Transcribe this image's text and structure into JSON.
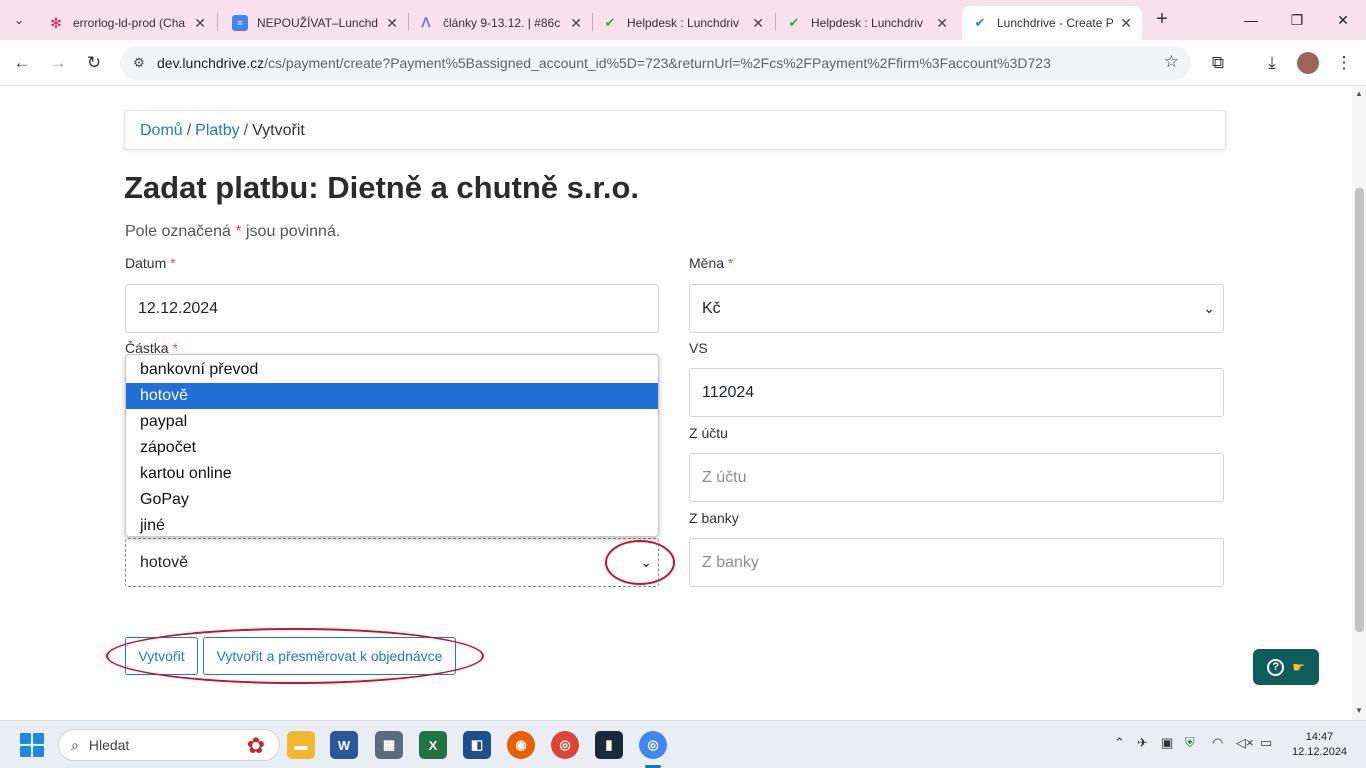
{
  "browser": {
    "tabs": [
      {
        "label": "errorlog-ld-prod (Cha",
        "icon": "slack-icon"
      },
      {
        "label": "NEPOUŽÍVAT–Lunchd",
        "icon": "docs-icon"
      },
      {
        "label": "články 9-13.12. | #86c",
        "icon": "clickup-icon"
      },
      {
        "label": "Helpdesk : Lunchdriv",
        "icon": "check-icon"
      },
      {
        "label": "Helpdesk : Lunchdriv",
        "icon": "check-icon"
      },
      {
        "label": "Lunchdrive - Create P",
        "icon": "check-icon",
        "active": true
      }
    ],
    "url_host": "dev.lunchdrive.cz",
    "url_path": "/cs/payment/create?Payment%5Bassigned_account_id%5D=723&returnUrl=%2Fcs%2FPayment%2Ffirm%3Faccount%3D723"
  },
  "breadcrumb": {
    "home": "Domů",
    "payments": "Platby",
    "sep": "/",
    "current": "Vytvořit"
  },
  "page": {
    "title": "Zadat platbu: Dietně a chutně s.r.o.",
    "required_note_before": "Pole označená ",
    "required_star": "*",
    "required_note_after": " jsou povinná."
  },
  "form": {
    "date_label": "Datum",
    "date_value": "12.12.2024",
    "currency_label": "Měna",
    "currency_value": "Kč",
    "amount_label": "Částka",
    "vs_label": "VS",
    "vs_value": "112024",
    "from_account_label": "Z účtu",
    "from_account_placeholder": "Z účtu",
    "from_bank_label": "Z banky",
    "from_bank_placeholder": "Z banky",
    "payment_type_value": "hotově",
    "payment_type_options": [
      "bankovní převod",
      "hotově",
      "paypal",
      "zápočet",
      "kartou online",
      "GoPay",
      "jiné"
    ],
    "payment_type_selected_index": 1
  },
  "buttons": {
    "create": "Vytvořit",
    "create_redirect": "Vytvořit a přesměrovat k objednávce"
  },
  "taskbar": {
    "search_placeholder": "Hledat",
    "time": "14:47",
    "date": "12.12.2024"
  }
}
